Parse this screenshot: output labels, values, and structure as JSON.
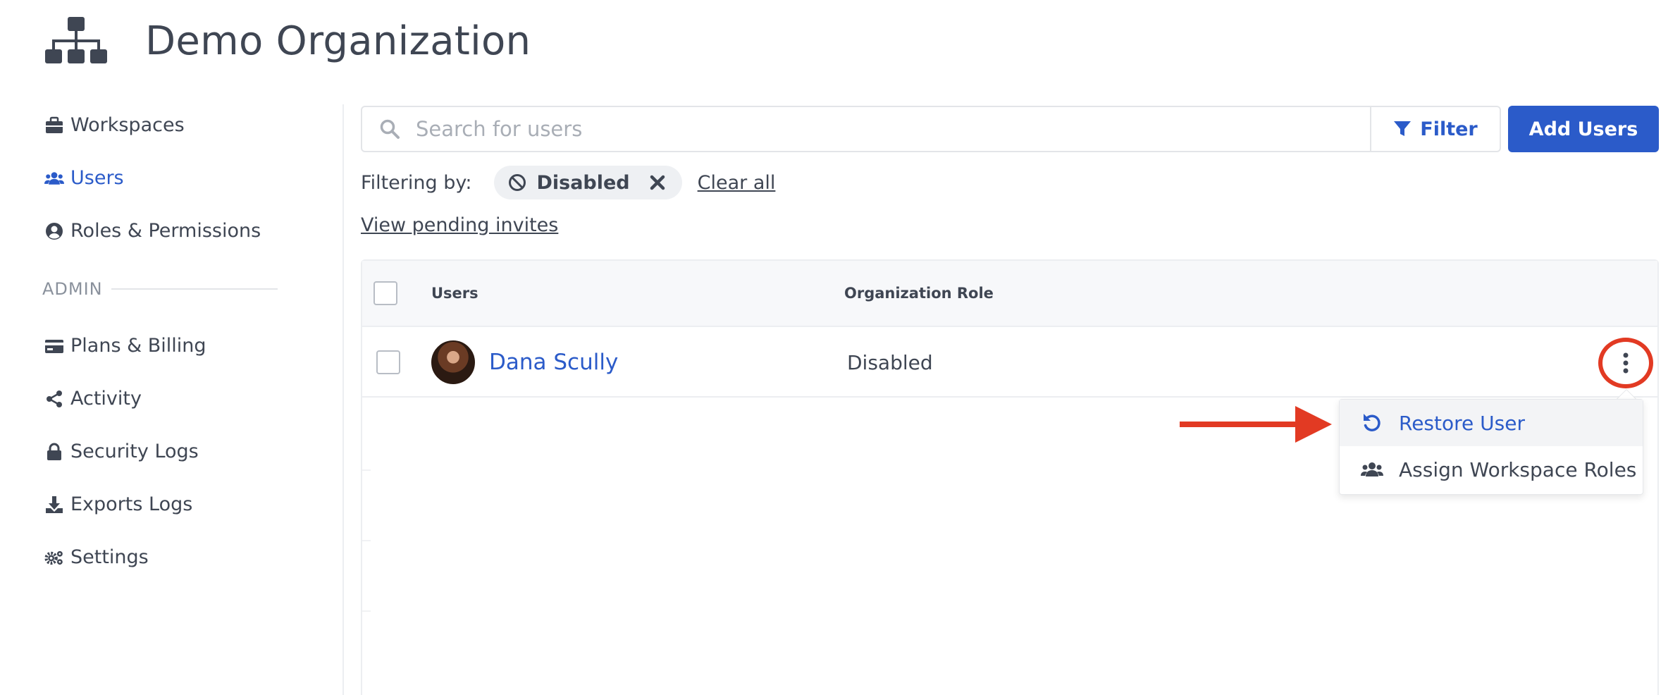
{
  "header": {
    "title": "Demo Organization",
    "icon": "sitemap-icon"
  },
  "sidebar": {
    "items": [
      {
        "label": "Workspaces",
        "icon": "briefcase-icon",
        "active": false
      },
      {
        "label": "Users",
        "icon": "users-icon",
        "active": true
      },
      {
        "label": "Roles & Permissions",
        "icon": "user-circle-icon",
        "active": false
      }
    ],
    "admin_label": "ADMIN",
    "admin_items": [
      {
        "label": "Plans & Billing",
        "icon": "credit-card-icon"
      },
      {
        "label": "Activity",
        "icon": "share-icon"
      },
      {
        "label": "Security Logs",
        "icon": "lock-icon"
      },
      {
        "label": "Exports Logs",
        "icon": "download-icon"
      },
      {
        "label": "Settings",
        "icon": "gears-icon"
      }
    ]
  },
  "toolbar": {
    "search_placeholder": "Search for users",
    "filter_label": "Filter",
    "add_users_label": "Add Users"
  },
  "filters": {
    "label": "Filtering by:",
    "active_chip": "Disabled",
    "clear_all": "Clear all",
    "view_pending": "View pending invites"
  },
  "table": {
    "columns": [
      "Users",
      "Organization Role"
    ],
    "rows": [
      {
        "name": "Dana Scully",
        "role": "Disabled"
      }
    ]
  },
  "row_menu": {
    "items": [
      {
        "label": "Restore User",
        "icon": "undo-icon"
      },
      {
        "label": "Assign Workspace Roles",
        "icon": "users-icon"
      }
    ]
  },
  "colors": {
    "accent": "#2b5bc9",
    "text": "#3f4653",
    "annotation": "#e23a23"
  }
}
